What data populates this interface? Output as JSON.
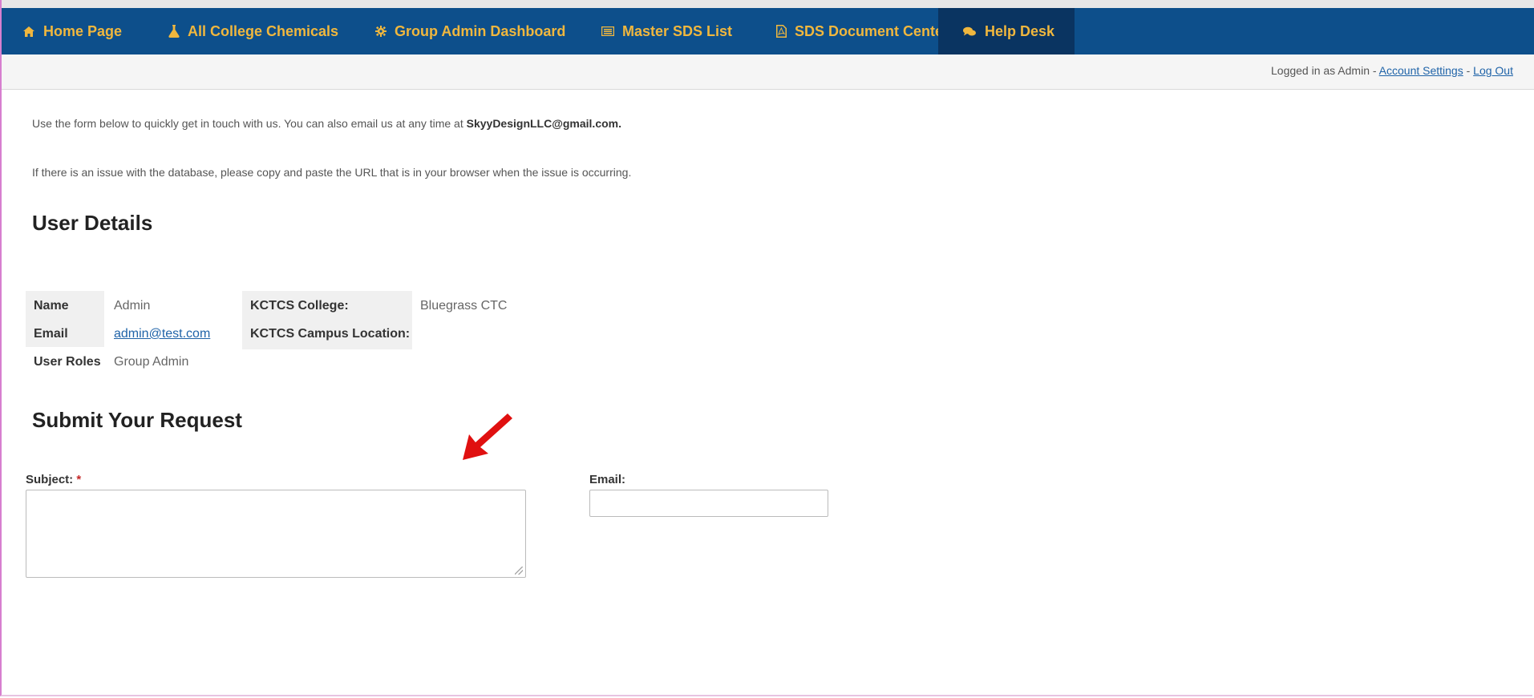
{
  "nav": {
    "items": [
      {
        "label": "Home Page",
        "icon": "home-icon"
      },
      {
        "label": "All College Chemicals",
        "icon": "flask-icon"
      },
      {
        "label": "Group Admin Dashboard",
        "icon": "gear-icon"
      },
      {
        "label": "Master SDS List",
        "icon": "list-icon"
      },
      {
        "label": "SDS Document Center",
        "icon": "pdf-icon"
      },
      {
        "label": "Help Desk",
        "icon": "chat-icon"
      }
    ],
    "active": "Help Desk",
    "bg_color": "#0d4f8b",
    "text_color": "#f0b73e"
  },
  "account": {
    "logged_in_text": "Logged in as Admin - ",
    "settings_link": "Account Settings",
    "separator": " - ",
    "logout_link": "Log Out"
  },
  "intro": {
    "line1_prefix": "Use the form below to quickly get in touch with us. You can also email us at any time at ",
    "email": "SkyyDesignLLC@gmail.com.",
    "line2": "If there is an issue with the database, please copy and paste the URL that is in your browser when the issue is occurring."
  },
  "user_details": {
    "heading": "User Details",
    "name_label": "Name",
    "name_value": "Admin",
    "email_label": "Email",
    "email_value": "admin@test.com",
    "roles_label": "User Roles",
    "roles_value": "Group Admin",
    "college_label": "KCTCS College:",
    "college_value": "Bluegrass CTC",
    "campus_label": "KCTCS Campus Location:",
    "campus_value": ""
  },
  "request": {
    "heading": "Submit Your Request",
    "subject_label": "Subject:",
    "required_mark": "*",
    "email_label": "Email:",
    "subject_value": "",
    "email_value": ""
  },
  "annotation": {
    "arrow_color": "#e01010"
  }
}
